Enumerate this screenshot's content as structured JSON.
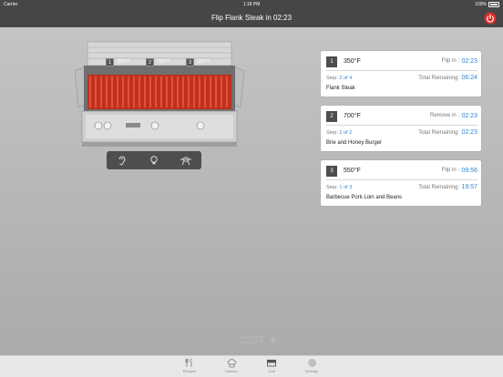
{
  "status_bar": {
    "carrier": "Carrier",
    "time": "1:18 PM",
    "battery": "100%"
  },
  "header": {
    "title": "Flip Flank Steak in 02:23"
  },
  "grill_zones": [
    {
      "num": "1",
      "temp": "350°F"
    },
    {
      "num": "2",
      "temp": "700°F"
    },
    {
      "num": "3",
      "temp": "550°F"
    }
  ],
  "cards": [
    {
      "zone": "1",
      "temp": "350°F",
      "action": "Flip in :",
      "action_time": "02:23",
      "step_label": "Step:",
      "step": "2 of 4",
      "remaining_label": "Total Remaining:",
      "remaining": "06:24",
      "food": "Flank Steak"
    },
    {
      "zone": "2",
      "temp": "700°F",
      "action": "Remove in :",
      "action_time": "02:23",
      "step_label": "Step:",
      "step": "2 of 2",
      "remaining_label": "Total Remaining:",
      "remaining": "02:23",
      "food": "Brie and Honey Burger"
    },
    {
      "zone": "3",
      "temp": "550°F",
      "action": "Flip in :",
      "action_time": "09:56",
      "step_label": "Step:",
      "step": "1 of 3",
      "remaining_label": "Total Remaining:",
      "remaining": "19:57",
      "food": "Barbecue Pork Loin and Beans"
    }
  ],
  "powered_by": {
    "line1": "Powered by",
    "line2": "MyChef™"
  },
  "tabs": [
    {
      "label": "Recipes",
      "icon": "utensils-icon"
    },
    {
      "label": "Kitchen",
      "icon": "chef-hat-icon"
    },
    {
      "label": "Grill",
      "icon": "grill-icon"
    },
    {
      "label": "Settings",
      "icon": "gear-icon"
    }
  ],
  "colors": {
    "accent": "#2f86d6",
    "power": "#e02b2b",
    "nav": "#464646"
  }
}
